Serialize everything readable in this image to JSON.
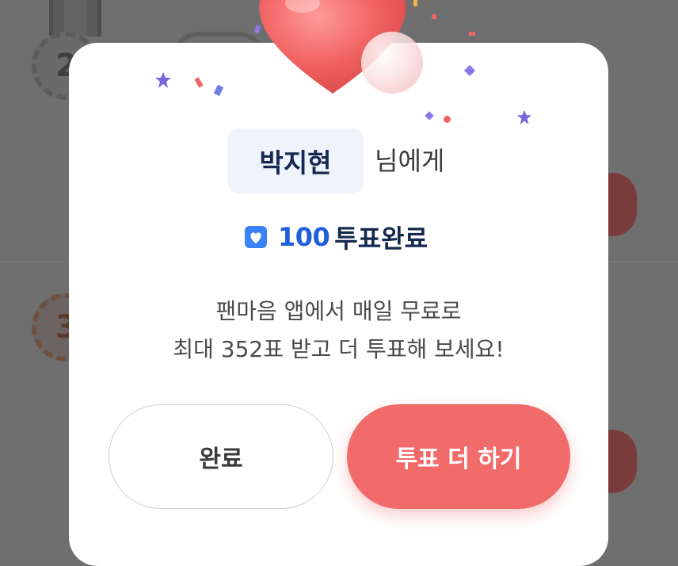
{
  "modal": {
    "recipient_name": "박지현",
    "recipient_suffix": "님에게",
    "vote_count": "100",
    "vote_status": "투표완료",
    "message_line1": "팬마음 앱에서 매일 무료로",
    "message_line2": "최대 352표 받고 더 투표해 보세요!",
    "done_button": "완료",
    "more_vote_button": "투표 더 하기"
  },
  "background": {
    "rank_2": "2",
    "rank_3": "3"
  },
  "colors": {
    "accent_red": "#f26b6b",
    "vote_blue": "#1f5fdb",
    "name_navy": "#15294f",
    "chip_bg": "#eef3fc",
    "dim_overlay": "#6f6f6f"
  },
  "icons": [
    "heart-3d-icon",
    "heart-badge-icon",
    "confetti"
  ]
}
